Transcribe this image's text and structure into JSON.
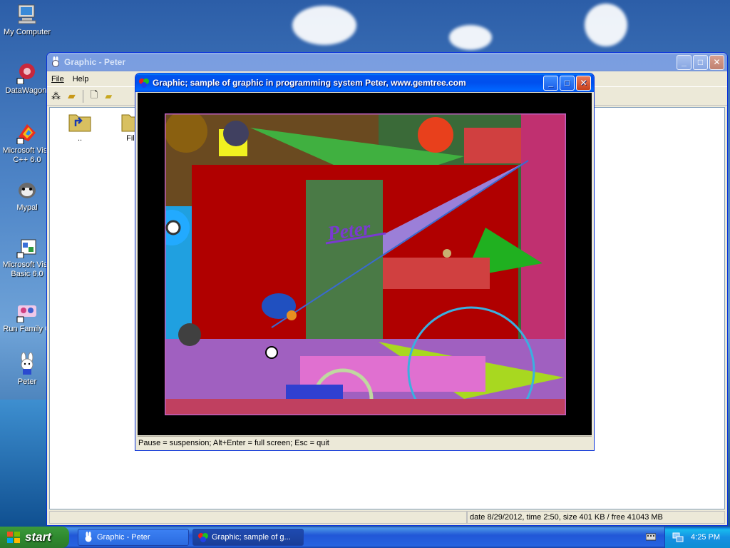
{
  "desktop": {
    "icons": [
      {
        "label": "My Computer",
        "icon": "computer-icon"
      },
      {
        "label": "DataWagon.",
        "icon": "datawagon-icon"
      },
      {
        "label": "Microsoft Visu C++ 6.0",
        "icon": "vcpp-icon"
      },
      {
        "label": "Mypal",
        "icon": "mypal-icon"
      },
      {
        "label": "Microsoft Visu Basic 6.0",
        "icon": "vb-icon"
      },
      {
        "label": "Run Family G",
        "icon": "family-icon"
      },
      {
        "label": "Peter",
        "icon": "peter-rabbit-icon"
      }
    ]
  },
  "explorer": {
    "title": "Graphic - Peter",
    "menu": [
      "File",
      "Help"
    ],
    "folders": [
      {
        "label": "..",
        "icon": "folder-up-icon"
      },
      {
        "label": "File",
        "icon": "folder-icon"
      }
    ],
    "status": "date 8/29/2012, time 2:50, size 401 KB / free 41043 MB"
  },
  "graphic_window": {
    "title": "Graphic;   sample of graphic in programming system Peter, www.gemtree.com",
    "canvas_text": "Peter",
    "status": "Pause = suspension;   Alt+Enter = full screen;   Esc = quit"
  },
  "taskbar": {
    "start_label": "start",
    "tasks": [
      {
        "label": "Graphic - Peter"
      },
      {
        "label": "Graphic;   sample of g..."
      }
    ],
    "clock": "4:25 PM"
  },
  "colors": {
    "xp_blue": "#0054e3",
    "canvas_red": "#b00000",
    "canvas_green": "#4a7a46",
    "canvas_violet": "#9b7fd8"
  }
}
